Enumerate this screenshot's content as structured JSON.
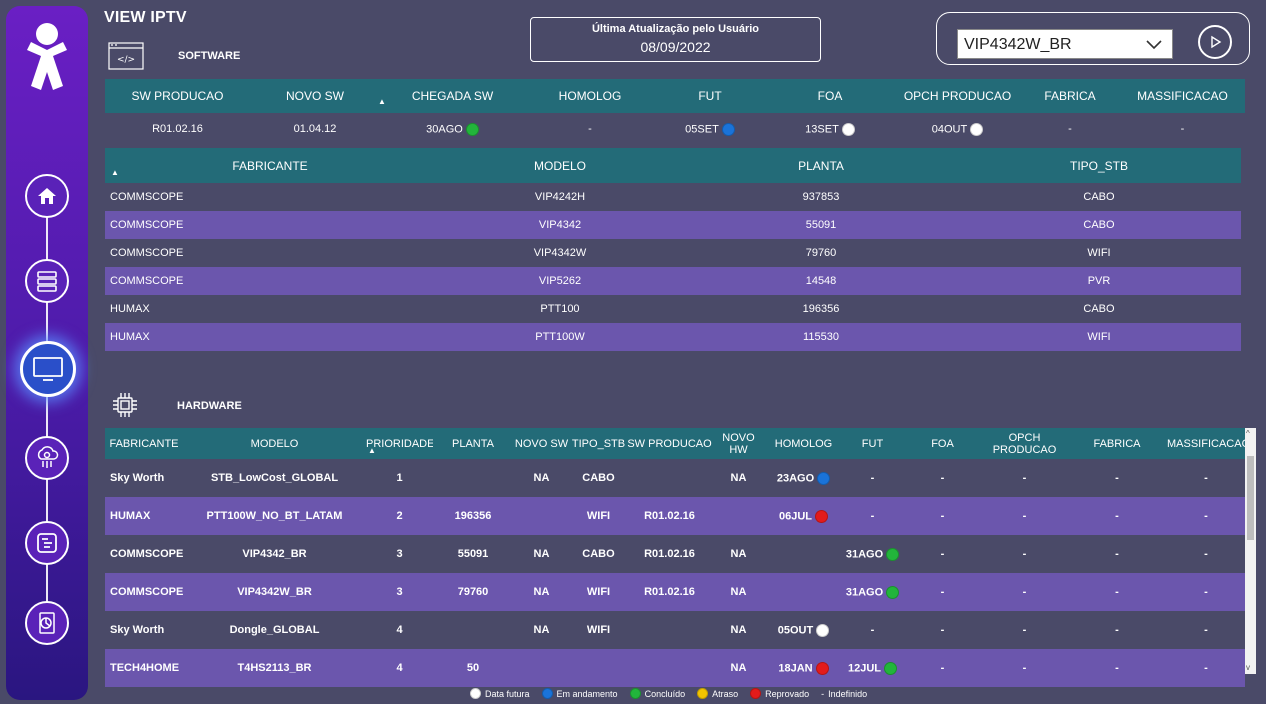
{
  "app": {
    "title": "VIEW IPTV"
  },
  "sections": {
    "software": "SOFTWARE",
    "hardware": "HARDWARE"
  },
  "update": {
    "label": "Última Atualização pelo Usuário",
    "date": "08/09/2022"
  },
  "selector": {
    "value": "VIP4342W_BR"
  },
  "icons": {
    "logo": "vivo-logo-icon",
    "nav": [
      "home-icon",
      "servers-icon",
      "monitor-icon",
      "cloud-chip-icon",
      "list-icon",
      "report-icon"
    ],
    "play": "play-icon",
    "software": "code-window-icon",
    "hardware": "chip-icon"
  },
  "colors": {
    "sidebar_top": "#6a1fc4",
    "sidebar_bottom": "#2a1680",
    "header_teal": "#236b78",
    "row_alt": "#6b56ad",
    "background": "#4a4a68"
  },
  "software_table": {
    "headers": [
      "SW PRODUCAO",
      "NOVO SW",
      "CHEGADA SW",
      "HOMOLOG",
      "FUT",
      "FOA",
      "OPCH PRODUCAO",
      "FABRICA",
      "MASSIFICACAO"
    ],
    "row": [
      {
        "text": "R01.02.16"
      },
      {
        "text": "01.04.12"
      },
      {
        "text": "30AGO",
        "status": "green"
      },
      {
        "text": "-"
      },
      {
        "text": "05SET",
        "status": "blue"
      },
      {
        "text": "13SET",
        "status": "white"
      },
      {
        "text": "04OUT",
        "status": "white"
      },
      {
        "text": "-"
      },
      {
        "text": "-"
      }
    ]
  },
  "model_table": {
    "headers": [
      "FABRICANTE",
      "MODELO",
      "PLANTA",
      "TIPO_STB"
    ],
    "rows": [
      [
        "COMMSCOPE",
        "VIP4242H",
        "937853",
        "CABO"
      ],
      [
        "COMMSCOPE",
        "VIP4342",
        "55091",
        "CABO"
      ],
      [
        "COMMSCOPE",
        "VIP4342W",
        "79760",
        "WIFI"
      ],
      [
        "COMMSCOPE",
        "VIP5262",
        "14548",
        "PVR"
      ],
      [
        "HUMAX",
        "PTT100",
        "196356",
        "CABO"
      ],
      [
        "HUMAX",
        "PTT100W",
        "115530",
        "WIFI"
      ]
    ]
  },
  "hardware_table": {
    "headers": [
      "FABRICANTE",
      "MODELO",
      "PRIORIDADE",
      "PLANTA",
      "NOVO SW",
      "TIPO_STB",
      "SW PRODUCAO",
      "NOVO HW",
      "HOMOLOG",
      "FUT",
      "FOA",
      "OPCH PRODUCAO",
      "FABRICA",
      "MASSIFICACAO"
    ],
    "rows": [
      [
        "Sky Worth",
        "STB_LowCost_GLOBAL",
        "1",
        "",
        "NA",
        "CABO",
        "",
        "NA",
        {
          "text": "23AGO",
          "status": "blue"
        },
        "-",
        "-",
        "-",
        "-",
        "-"
      ],
      [
        "HUMAX",
        "PTT100W_NO_BT_LATAM",
        "2",
        "196356",
        "",
        "WIFI",
        "R01.02.16",
        "",
        {
          "text": "06JUL",
          "status": "red"
        },
        "-",
        "-",
        "-",
        "-",
        "-"
      ],
      [
        "COMMSCOPE",
        "VIP4342_BR",
        "3",
        "55091",
        "NA",
        "CABO",
        "R01.02.16",
        "NA",
        "",
        {
          "text": "31AGO",
          "status": "green"
        },
        "-",
        "-",
        "-",
        "-"
      ],
      [
        "COMMSCOPE",
        "VIP4342W_BR",
        "3",
        "79760",
        "NA",
        "WIFI",
        "R01.02.16",
        "NA",
        "",
        {
          "text": "31AGO",
          "status": "green"
        },
        "-",
        "-",
        "-",
        "-"
      ],
      [
        "Sky Worth",
        "Dongle_GLOBAL",
        "4",
        "",
        "NA",
        "WIFI",
        "",
        "NA",
        {
          "text": "05OUT",
          "status": "white"
        },
        "-",
        "-",
        "-",
        "-",
        "-"
      ],
      [
        "TECH4HOME",
        "T4HS2113_BR",
        "4",
        "50",
        "",
        "",
        "",
        "NA",
        {
          "text": "18JAN",
          "status": "red"
        },
        {
          "text": "12JUL",
          "status": "green"
        },
        "-",
        "-",
        "-",
        "-"
      ]
    ]
  },
  "legend": [
    {
      "label": "Data futura",
      "status": "white"
    },
    {
      "label": "Em andamento",
      "status": "blue"
    },
    {
      "label": "Concluído",
      "status": "green"
    },
    {
      "label": "Atraso",
      "status": "yellow"
    },
    {
      "label": "Reprovado",
      "status": "red"
    },
    {
      "label": "Indefinido",
      "status": "dash"
    }
  ]
}
